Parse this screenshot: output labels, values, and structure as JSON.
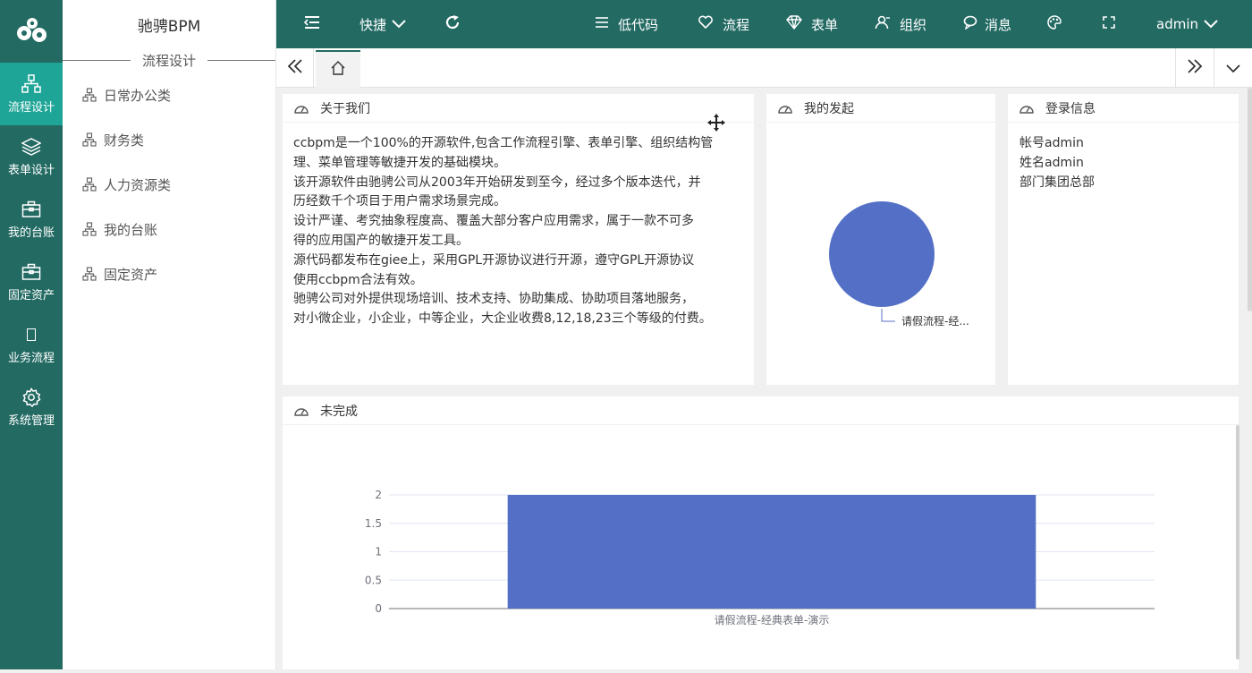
{
  "app": {
    "title": "驰骋BPM"
  },
  "leftnav": [
    {
      "label": "流程设计",
      "icon": "flow-design-icon",
      "active": true
    },
    {
      "label": "表单设计",
      "icon": "layers-icon"
    },
    {
      "label": "我的台账",
      "icon": "briefcase-icon"
    },
    {
      "label": "固定资产",
      "icon": "briefcase-icon"
    },
    {
      "label": "业务流程",
      "icon": "blank-icon"
    },
    {
      "label": "系统管理",
      "icon": "gear-icon"
    }
  ],
  "subnav": {
    "section": "流程设计",
    "items": [
      "日常办公类",
      "财务类",
      "人力资源类",
      "我的台账",
      "固定资产"
    ]
  },
  "topbar": {
    "shortcut": "快捷",
    "lowcode": "低代码",
    "flow": "流程",
    "form": "表单",
    "org": "组织",
    "message": "消息",
    "user": "admin"
  },
  "about": {
    "title": "关于我们",
    "lines": [
      "ccbpm是一个100%的开源软件,包含工作流程引擎、表单引擎、组织结构管",
      "理、菜单管理等敏捷开发的基础模块。",
      "该开源软件由驰骋公司从2003年开始研发到至今，经过多个版本迭代，并",
      "历经数千个项目于用户需求场景完成。",
      "设计严谨、考究抽象程度高、覆盖大部分客户应用需求，属于一款不可多",
      "得的应用国产的敏捷开发工具。",
      "源代码都发布在giee上，采用GPL开源协议进行开源，遵守GPL开源协议",
      "使用ccbpm合法有效。",
      "驰骋公司对外提供现场培训、技术支持、协助集成、协助项目落地服务，",
      "对小微企业，小企业，中等企业，大企业收费8,12,18,23三个等级的付费。"
    ]
  },
  "started": {
    "title": "我的发起",
    "chart_data": {
      "type": "pie",
      "slices": [
        {
          "label": "请假流程-经...",
          "value": 1,
          "color": "#5470c6"
        }
      ]
    }
  },
  "login": {
    "title": "登录信息",
    "account": "帐号admin",
    "name": "姓名admin",
    "dept": "部门集团总部"
  },
  "unfinished": {
    "title": "未完成",
    "chart_data": {
      "type": "bar",
      "categories": [
        "请假流程-经典表单-演示"
      ],
      "values": [
        2
      ],
      "ylim": [
        0,
        2
      ],
      "yticks": [
        "0",
        "0.5",
        "1",
        "1.5",
        "2"
      ],
      "color": "#5470c6",
      "grid": true
    }
  },
  "colors": {
    "primary": "#236a63",
    "active": "#1fa597",
    "chart": "#5470c6"
  }
}
